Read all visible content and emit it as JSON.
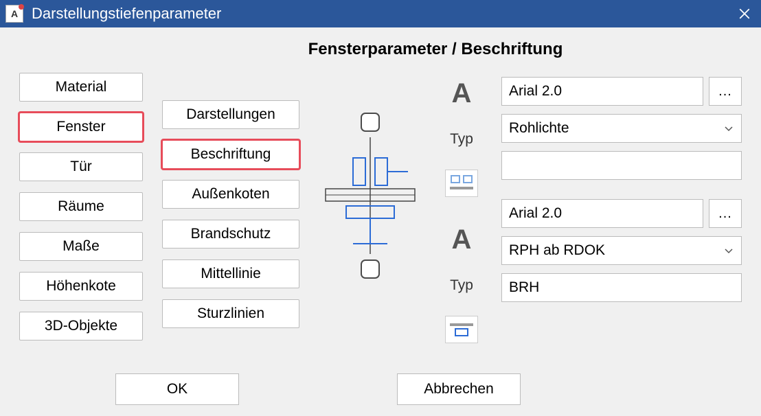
{
  "window": {
    "title": "Darstellungstiefenparameter",
    "icon_label": "A"
  },
  "heading": "Fensterparameter / Beschriftung",
  "primary_tabs": [
    {
      "label": "Material",
      "selected": false
    },
    {
      "label": "Fenster",
      "selected": true
    },
    {
      "label": "Tür",
      "selected": false
    },
    {
      "label": "Räume",
      "selected": false
    },
    {
      "label": "Maße",
      "selected": false
    },
    {
      "label": "Höhenkote",
      "selected": false
    },
    {
      "label": "3D-Objekte",
      "selected": false
    }
  ],
  "secondary_tabs": [
    {
      "label": "Darstellungen",
      "selected": false
    },
    {
      "label": "Beschriftung",
      "selected": true
    },
    {
      "label": "Außenkoten",
      "selected": false
    },
    {
      "label": "Brandschutz",
      "selected": false
    },
    {
      "label": "Mittellinie",
      "selected": false
    },
    {
      "label": "Sturzlinien",
      "selected": false
    }
  ],
  "labels": {
    "typ": "Typ",
    "A": "A",
    "browse": "..."
  },
  "upper": {
    "font_value": "Arial 2.0",
    "typ_value": "Rohlichte",
    "prefix_value": ""
  },
  "lower": {
    "font_value": "Arial 2.0",
    "typ_value": "RPH ab RDOK",
    "prefix_value": "BRH"
  },
  "footer": {
    "ok": "OK",
    "cancel": "Abbrechen"
  }
}
